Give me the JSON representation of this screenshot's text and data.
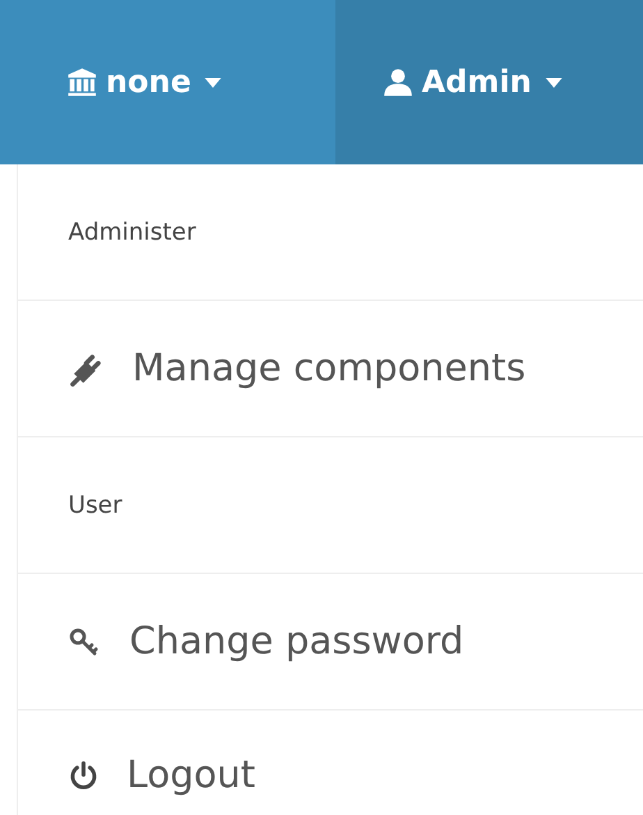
{
  "navbar": {
    "tabs": [
      {
        "label": "none",
        "selected": false
      },
      {
        "label": "Admin",
        "selected": true
      }
    ]
  },
  "menu": {
    "items": [
      {
        "kind": "header",
        "label": "Administer"
      },
      {
        "kind": "link",
        "label": "Manage components"
      },
      {
        "kind": "header",
        "label": "User"
      },
      {
        "kind": "link",
        "label": "Change password"
      },
      {
        "kind": "link",
        "label": "Logout"
      }
    ]
  }
}
